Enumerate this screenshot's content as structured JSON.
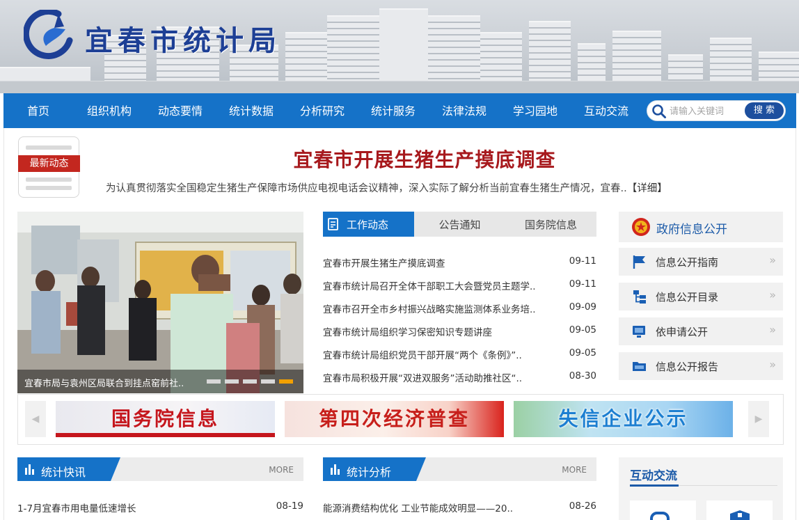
{
  "site": {
    "title": "宜春市统计局"
  },
  "nav": {
    "items": [
      "首页",
      "组织机构",
      "动态要情",
      "统计数据",
      "分析研究",
      "统计服务",
      "法律法规",
      "学习园地",
      "互动交流"
    ],
    "search_placeholder": "请输入关键词",
    "search_button": "搜 索"
  },
  "headline": {
    "badge": "最新动态",
    "title": "宜春市开展生猪生产摸底调查",
    "summary": "为认真贯彻落实全国稳定生猪生产保障市场供应电视电话会议精神，深入实际了解分析当前宜春生猪生产情况，宜春..",
    "detail": "【详细】"
  },
  "slideshow": {
    "caption": "宜春市局与袁州区局联合到挂点窑前社..",
    "active_dot": 5,
    "dot_count": 5
  },
  "tabs": {
    "items": [
      "工作动态",
      "公告通知",
      "国务院信息"
    ],
    "active": 0
  },
  "news_list": [
    {
      "title": "宜春市开展生猪生产摸底调查",
      "date": "09-11"
    },
    {
      "title": "宜春市统计局召开全体干部职工大会暨党员主题学..",
      "date": "09-11"
    },
    {
      "title": "宜春市召开全市乡村振兴战略实施监测体系业务培..",
      "date": "09-09"
    },
    {
      "title": "宜春市统计局组织学习保密知识专题讲座",
      "date": "09-05"
    },
    {
      "title": "宜春市统计局组织党员干部开展“两个《条例》”..",
      "date": "09-05"
    },
    {
      "title": "宜春市局积极开展“双进双服务”活动助推社区“..",
      "date": "08-30"
    }
  ],
  "gov_panel": {
    "title": "政府信息公开",
    "items": [
      "信息公开指南",
      "信息公开目录",
      "依申请公开",
      "信息公开报告"
    ],
    "chevron": "»"
  },
  "banners": {
    "items": [
      "国务院信息",
      "第四次经济普查",
      "失信企业公示"
    ],
    "prev": "◀",
    "next": "▶"
  },
  "sections": {
    "quick": {
      "title": "统计快讯",
      "more": "MORE",
      "items": [
        {
          "title": "1-7月宜春市用电量低速增长",
          "date": "08-19"
        }
      ]
    },
    "analysis": {
      "title": "统计分析",
      "more": "MORE",
      "items": [
        {
          "title": "能源消费结构优化 工业节能成效明显——20..",
          "date": "08-26"
        }
      ]
    },
    "interact": {
      "title": "互动交流"
    }
  },
  "colors": {
    "nav_blue": "#1572c8",
    "headline_red": "#a7191d",
    "badge_red": "#c3271f",
    "brand_navy": "#1d3f95",
    "active_dot": "#f2a000"
  }
}
